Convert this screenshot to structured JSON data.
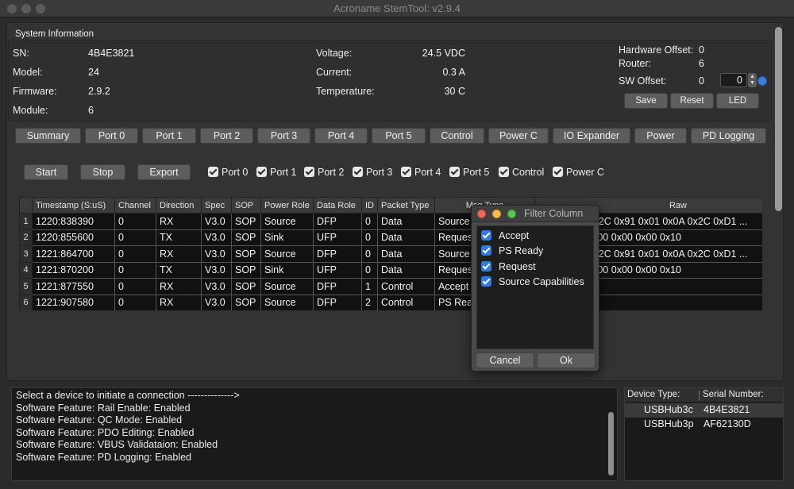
{
  "window": {
    "title": "Acroname StemTool: v2.9.4"
  },
  "system_info": {
    "legend": "System Information",
    "sn_label": "SN:",
    "sn": "4B4E3821",
    "model_label": "Model:",
    "model": "24",
    "firmware_label": "Firmware:",
    "firmware": "2.9.2",
    "module_label": "Module:",
    "module": "6",
    "voltage_label": "Voltage:",
    "voltage": "24.5 VDC",
    "current_label": "Current:",
    "current": "0.3 A",
    "temperature_label": "Temperature:",
    "temperature": "30 C",
    "hw_offset_label": "Hardware Offset:",
    "hw_offset": "0",
    "router_label": "Router:",
    "router": "6",
    "sw_offset_label": "SW Offset:",
    "sw_offset": "0",
    "sw_offset_input": "0",
    "save": "Save",
    "reset": "Reset",
    "led": "LED"
  },
  "tabs": [
    "Summary",
    "Port 0",
    "Port 1",
    "Port 2",
    "Port 3",
    "Port 4",
    "Port 5",
    "Control",
    "Power C",
    "IO Expander",
    "Power",
    "PD Logging"
  ],
  "controls": {
    "start": "Start",
    "stop": "Stop",
    "export": "Export"
  },
  "port_filters": [
    "Port 0",
    "Port 1",
    "Port 2",
    "Port 3",
    "Port 4",
    "Port 5",
    "Control",
    "Power C"
  ],
  "table": {
    "columns": [
      "Timestamp (S:uS)",
      "Channel",
      "Direction",
      "Spec",
      "SOP",
      "Power Role",
      "Data Role",
      "ID",
      "Packet Type",
      "Msg Type",
      "Raw"
    ],
    "rows": [
      {
        "n": "1",
        "ts": "1220:838390",
        "ch": "0",
        "dir": "RX",
        "spec": "V3.0",
        "sop": "SOP",
        "pr": "Source",
        "dr": "DFP",
        "id": "0",
        "pt": "Data",
        "mt": "Source Capabilities",
        "raw": "0xA1 0x31 0x2C 0x91 0x01 0x0A 0x2C 0xD1 ..."
      },
      {
        "n": "2",
        "ts": "1220:855600",
        "ch": "0",
        "dir": "TX",
        "spec": "V3.0",
        "sop": "SOP",
        "pr": "Sink",
        "dr": "UFP",
        "id": "0",
        "pt": "Data",
        "mt": "Request",
        "raw": "0x42 0x10 0x00 0x00 0x00 0x10"
      },
      {
        "n": "3",
        "ts": "1221:864700",
        "ch": "0",
        "dir": "RX",
        "spec": "V3.0",
        "sop": "SOP",
        "pr": "Source",
        "dr": "DFP",
        "id": "0",
        "pt": "Data",
        "mt": "Source Capabilities",
        "raw": "0xA1 0x31 0x2C 0x91 0x01 0x0A 0x2C 0xD1 ..."
      },
      {
        "n": "4",
        "ts": "1221:870200",
        "ch": "0",
        "dir": "TX",
        "spec": "V3.0",
        "sop": "SOP",
        "pr": "Sink",
        "dr": "UFP",
        "id": "0",
        "pt": "Data",
        "mt": "Request",
        "raw": "0x42 0x10 0x00 0x00 0x00 0x10"
      },
      {
        "n": "5",
        "ts": "1221:877550",
        "ch": "0",
        "dir": "RX",
        "spec": "V3.0",
        "sop": "SOP",
        "pr": "Source",
        "dr": "DFP",
        "id": "1",
        "pt": "Control",
        "mt": "Accept",
        "raw": ""
      },
      {
        "n": "6",
        "ts": "1221:907580",
        "ch": "0",
        "dir": "RX",
        "spec": "V3.0",
        "sop": "SOP",
        "pr": "Source",
        "dr": "DFP",
        "id": "2",
        "pt": "Control",
        "mt": "PS Ready",
        "raw": ""
      }
    ]
  },
  "filter_dialog": {
    "title": "Filter Column",
    "items": [
      "Accept",
      "PS Ready",
      "Request",
      "Source Capabilities"
    ],
    "cancel": "Cancel",
    "ok": "Ok"
  },
  "log": [
    "Select a device to initiate a connection -------------->",
    "Software Feature: Rail Enable: Enabled",
    "Software Feature: QC Mode: Enabled",
    "Software Feature: PDO Editing: Enabled",
    "Software Feature: VBUS Validataion: Enabled",
    "Software Feature: PD Logging: Enabled"
  ],
  "devices": {
    "type_header": "Device Type:",
    "serial_header": "Serial Number:",
    "rows": [
      {
        "type": "USBHub3c",
        "serial": "4B4E3821"
      },
      {
        "type": "USBHub3p",
        "serial": "AF62130D"
      }
    ]
  }
}
